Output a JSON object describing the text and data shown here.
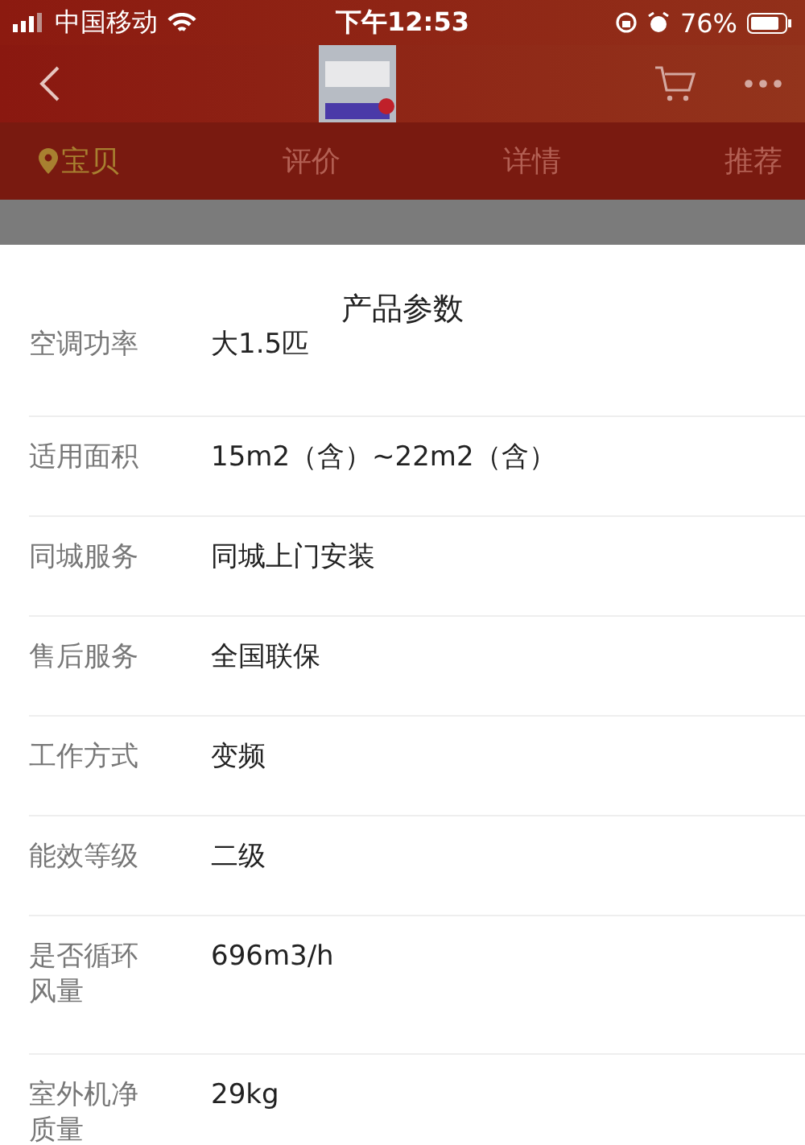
{
  "status_bar": {
    "carrier": "中国移动",
    "time": "下午12:53",
    "battery": "76%"
  },
  "tabs": [
    {
      "label": "宝贝",
      "selected": true
    },
    {
      "label": "评价",
      "selected": false
    },
    {
      "label": "详情",
      "selected": false
    },
    {
      "label": "推荐",
      "selected": false
    }
  ],
  "sheet": {
    "title": "产品参数",
    "rows": [
      {
        "label": "空调功率",
        "value": "大1.5匹"
      },
      {
        "label": "适用面积",
        "value": "15m2（含）~22m2（含）"
      },
      {
        "label": "同城服务",
        "value": "同城上门安装"
      },
      {
        "label": "售后服务",
        "value": "全国联保"
      },
      {
        "label": "工作方式",
        "value": "变频"
      },
      {
        "label": "能效等级",
        "value": "二级"
      },
      {
        "label": "是否循环风量",
        "value": "696m3/h"
      },
      {
        "label": "室外机净质量",
        "value": "29kg"
      }
    ]
  }
}
